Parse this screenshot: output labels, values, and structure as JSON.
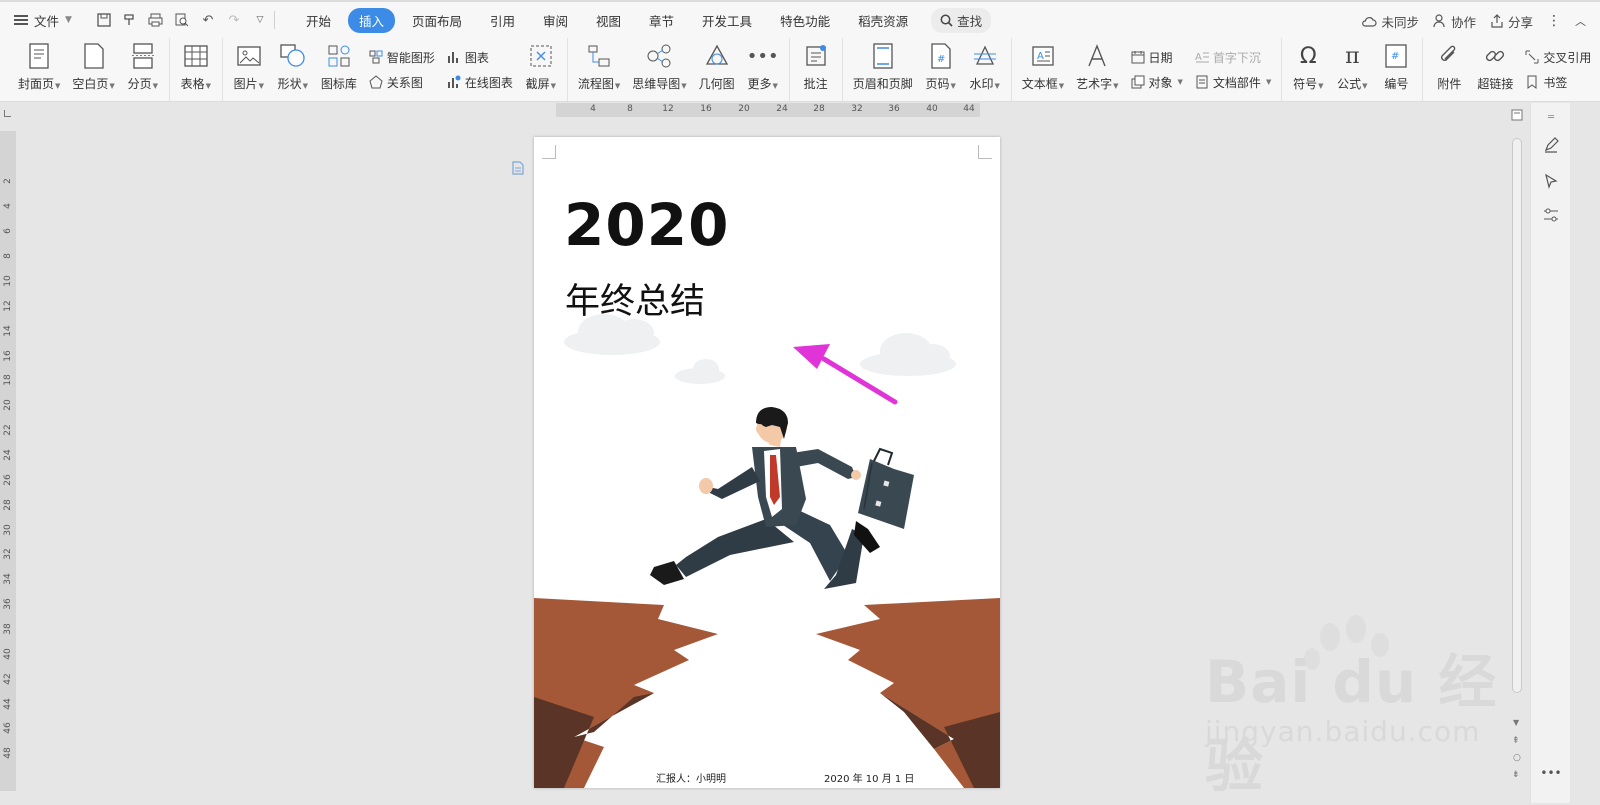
{
  "menubar": {
    "file_label": "文件",
    "tabs": [
      "开始",
      "插入",
      "页面布局",
      "引用",
      "审阅",
      "视图",
      "章节",
      "开发工具",
      "特色功能",
      "稻壳资源"
    ],
    "active_tab": "插入",
    "search_label": "查找",
    "right": {
      "sync": "未同步",
      "collab": "协作",
      "share": "分享"
    }
  },
  "ribbon": {
    "cover": "封面页",
    "blank": "空白页",
    "pagebreak": "分页",
    "table": "表格",
    "picture": "图片",
    "shape": "形状",
    "iconlib": "图标库",
    "smartart": "智能图形",
    "chart": "图表",
    "relation": "关系图",
    "online_chart": "在线图表",
    "screenshot": "截屏",
    "flowchart": "流程图",
    "mindmap": "思维导图",
    "geometry": "几何图",
    "more": "更多",
    "comment": "批注",
    "header_footer": "页眉和页脚",
    "page_number": "页码",
    "watermark": "水印",
    "textbox": "文本框",
    "wordart": "艺术字",
    "date": "日期",
    "object": "对象",
    "dropcap": "首字下沉",
    "docparts": "文档部件",
    "symbol": "符号",
    "formula": "公式",
    "numbering": "编号",
    "attachment": "附件",
    "hyperlink": "超链接",
    "crossref": "交叉引用",
    "bookmark": "书签"
  },
  "ruler": {
    "h_ticks": [
      "4",
      "8",
      "12",
      "16",
      "20",
      "24",
      "28",
      "32",
      "36",
      "40",
      "44"
    ],
    "v_ticks": [
      "2",
      "4",
      "6",
      "8",
      "10",
      "12",
      "14",
      "16",
      "18",
      "20",
      "22",
      "24",
      "26",
      "28",
      "30",
      "32",
      "34",
      "36",
      "38",
      "40",
      "42",
      "44",
      "46",
      "48"
    ]
  },
  "document": {
    "year": "2020",
    "subtitle": "年终总结",
    "reporter": "汇报人：小明明",
    "date": "2020 年 10 月 1 日"
  },
  "watermark": {
    "line1": "Bai du 经验",
    "line2": "jingyan.baidu.com"
  },
  "colors": {
    "accent": "#3c8ce7",
    "arrow": "#e033d8",
    "cliff": "#a0563a",
    "suit": "#3a4852"
  }
}
